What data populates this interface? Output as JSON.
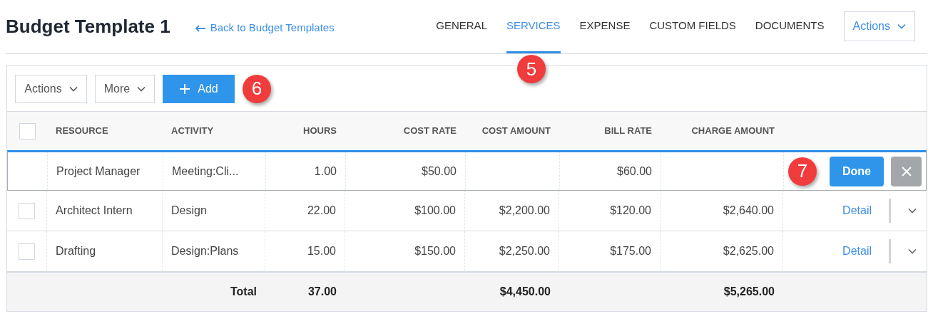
{
  "header": {
    "title": "Budget Template 1",
    "back_link": "Back to Budget Templates"
  },
  "tabs": [
    {
      "label": "GENERAL",
      "selected": false
    },
    {
      "label": "SERVICES",
      "selected": true,
      "annotation": "5"
    },
    {
      "label": "EXPENSE",
      "selected": false
    },
    {
      "label": "CUSTOM FIELDS",
      "selected": false
    },
    {
      "label": "DOCUMENTS",
      "selected": false
    }
  ],
  "actions_menu": "Actions",
  "toolbar": {
    "actions": "Actions",
    "more": "More",
    "add": "Add",
    "annotation": "6"
  },
  "table": {
    "columns": [
      {
        "label": "RESOURCE"
      },
      {
        "label": "ACTIVITY"
      },
      {
        "label": "HOURS"
      },
      {
        "label": "COST RATE"
      },
      {
        "label": "COST AMOUNT"
      },
      {
        "label": "BILL RATE"
      },
      {
        "label": "CHARGE AMOUNT"
      }
    ],
    "header_checked": false,
    "rows": [
      {
        "kind": "editing",
        "cells": [
          "Project Manager",
          "Meeting:Cli...",
          "1.00",
          "$50.00",
          "",
          "$60.00",
          ""
        ],
        "done": "Done",
        "annotation": "7"
      },
      {
        "kind": "normal",
        "checked": false,
        "cells": [
          "Architect Intern",
          "Design",
          "22.00",
          "$100.00",
          "$2,200.00",
          "$120.00",
          "$2,640.00"
        ],
        "detail": "Detail"
      },
      {
        "kind": "normal",
        "checked": false,
        "cells": [
          "Drafting",
          "Design:Plans",
          "15.00",
          "$150.00",
          "$2,250.00",
          "$175.00",
          "$2,625.00"
        ],
        "detail": "Detail"
      }
    ],
    "totals": {
      "label": "Total",
      "hours": "37.00",
      "cost_amount": "$4,450.00",
      "charge_amount": "$5,265.00"
    }
  }
}
